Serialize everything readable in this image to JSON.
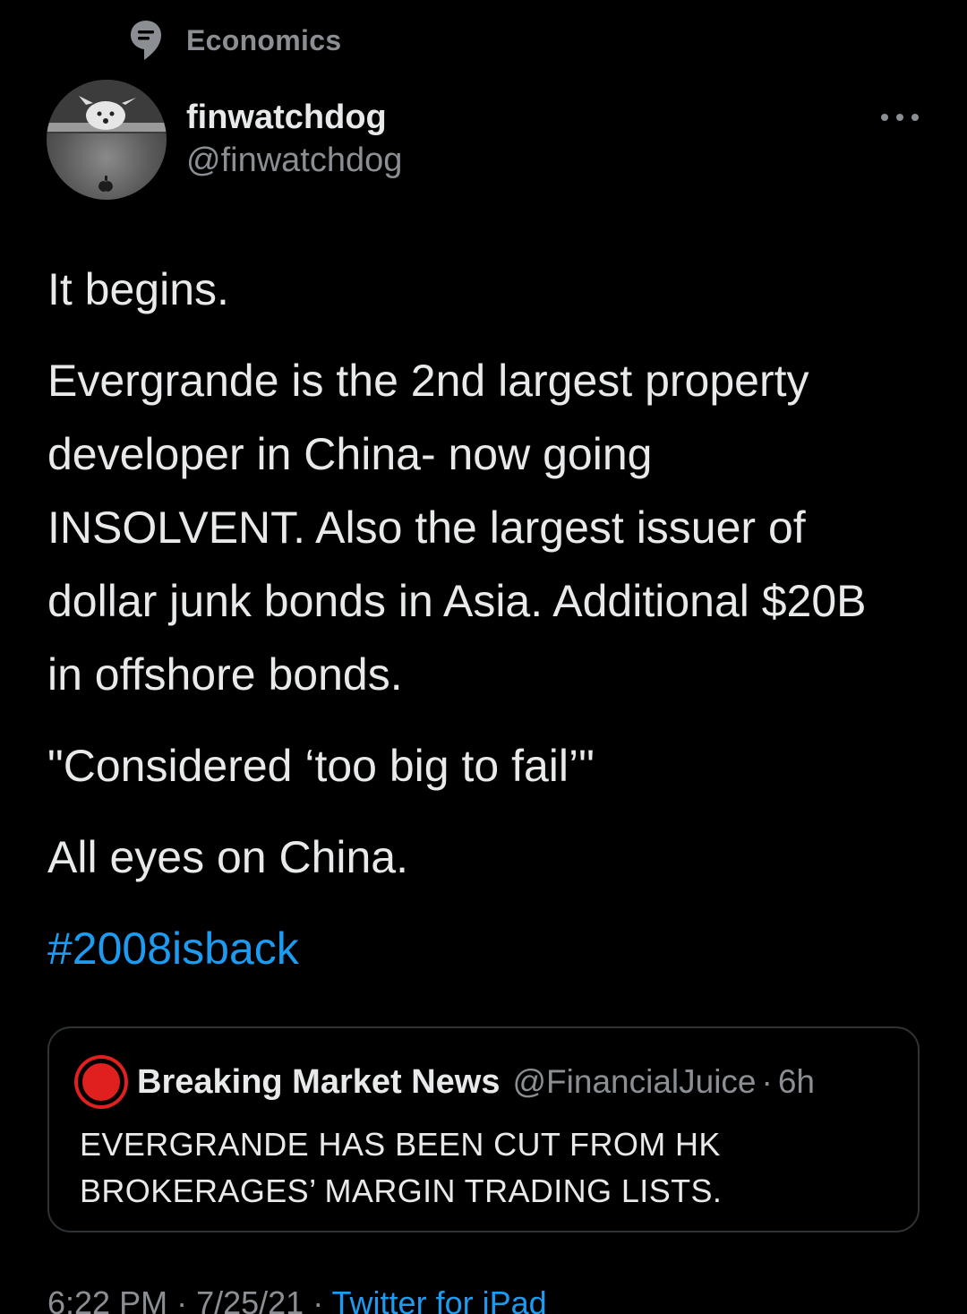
{
  "topic": {
    "label": "Economics",
    "icon": "topic-bubble-icon"
  },
  "author": {
    "display_name": "finwatchdog",
    "handle": "@finwatchdog",
    "avatar_icon": "dog-avatar"
  },
  "more_icon": "more-dots-icon",
  "tweet": {
    "p1": "It begins.",
    "p2": "Evergrande is the 2nd largest property developer in China- now going INSOLVENT. Also the largest issuer of dollar junk bonds in Asia. Additional $20B in offshore bonds.",
    "p3": "\"Considered ‘too big to fail’\"",
    "p4": "All eyes on China.",
    "hashtag": "#2008isback"
  },
  "quote": {
    "name": "Breaking Market News",
    "handle": "@FinancialJuice",
    "separator": "·",
    "time": "6h",
    "text": "EVERGRANDE HAS BEEN CUT FROM HK BROKERAGES’ MARGIN TRADING LISTS.",
    "avatar_color": "#e0201e"
  },
  "meta": {
    "time": "6:22 PM",
    "sep1": " · ",
    "date": "7/25/21",
    "sep2": " · ",
    "source": "Twitter for iPad"
  },
  "colors": {
    "background": "#000000",
    "text": "#e7e9ea",
    "secondary": "#8b8f94",
    "link": "#1d9bf0",
    "border": "#2f3336"
  }
}
